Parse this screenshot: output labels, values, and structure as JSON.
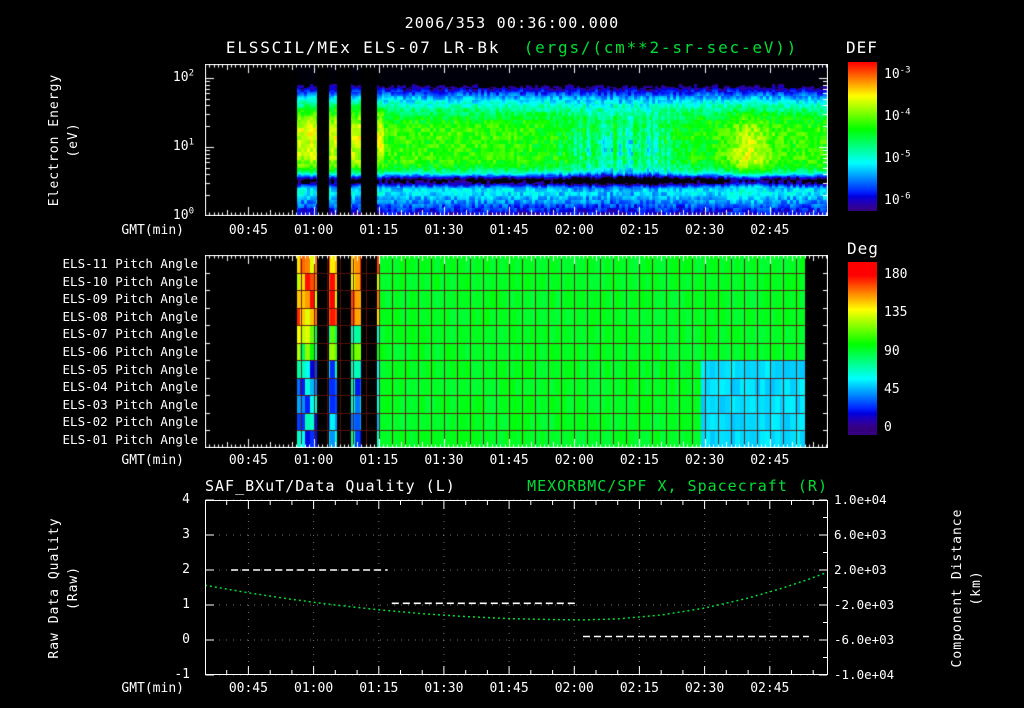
{
  "colors": {
    "accent_green": "#00dd33",
    "background": "#000000",
    "foreground": "#ffffff"
  },
  "header": {
    "timestamp": "2006/353 00:36:00.000"
  },
  "time_axis": {
    "label": "GMT(min)",
    "ticks": [
      "00:45",
      "01:00",
      "01:15",
      "01:30",
      "01:45",
      "02:00",
      "02:15",
      "02:30",
      "02:45"
    ],
    "tick_minutes": [
      45,
      60,
      75,
      90,
      105,
      120,
      135,
      150,
      165
    ],
    "start_min": 35,
    "end_min": 178.4
  },
  "spectrogram_panel": {
    "title": "ELSSCIL/MEx ELS-07 LR-Bk",
    "units": "(ergs/(cm**2-sr-sec-eV))",
    "ylabel_line1": "Electron Energy",
    "ylabel_line2": "(eV)",
    "yticks": [
      {
        "base": "10",
        "exp": "2",
        "value": 2
      },
      {
        "base": "10",
        "exp": "1",
        "value": 1
      },
      {
        "base": "10",
        "exp": "0",
        "value": 0
      }
    ],
    "y_decades_max": 2.2,
    "colorbar": {
      "title": "DEF",
      "ticks": [
        {
          "base": "10",
          "exp": "-3",
          "value": -3
        },
        {
          "base": "10",
          "exp": "-4",
          "value": -4
        },
        {
          "base": "10",
          "exp": "-5",
          "value": -5
        },
        {
          "base": "10",
          "exp": "-6",
          "value": -6
        }
      ],
      "display_range": [
        -2.69,
        -6.24
      ]
    }
  },
  "pitch_panel": {
    "rows": [
      "ELS-11 Pitch Angle",
      "ELS-10 Pitch Angle",
      "ELS-09 Pitch Angle",
      "ELS-08 Pitch Angle",
      "ELS-07 Pitch Angle",
      "ELS-06 Pitch Angle",
      "ELS-05 Pitch Angle",
      "ELS-04 Pitch Angle",
      "ELS-03 Pitch Angle",
      "ELS-02 Pitch Angle",
      "ELS-01 Pitch Angle"
    ],
    "colorbar": {
      "title": "Deg",
      "tick_labels": [
        "180",
        "135",
        "90",
        "45",
        "0"
      ],
      "tick_values": [
        180,
        135,
        90,
        45,
        0
      ],
      "display_range": [
        195,
        -8
      ]
    }
  },
  "line_panel": {
    "title_left": "SAF_BXuT/Data Quality (L)",
    "title_right": "MEXORBMC/SPF X, Spacecraft (R)",
    "ylabel_left_line1": "Raw Data Quality",
    "ylabel_left_line2": "(Raw)",
    "ylabel_right_line1": "Component Distance",
    "ylabel_right_line2": "(km)",
    "yticks_left": [
      "4",
      "3",
      "2",
      "1",
      "0",
      "-1"
    ],
    "ytick_values_left": [
      4,
      3,
      2,
      1,
      0,
      -1
    ],
    "yticks_right": [
      "1.0e+04",
      "6.0e+03",
      "2.0e+03",
      "-2.0e+03",
      "-6.0e+03",
      "-1.0e+04"
    ],
    "ytick_values_right": [
      10000,
      6000,
      2000,
      -2000,
      -6000,
      -10000
    ]
  },
  "chart_data": [
    {
      "type": "heatmap",
      "name": "electron_energy_spectrogram",
      "title": "ELSSCIL/MEx ELS-07 LR-Bk (ergs/(cm**2-sr-sec-eV))",
      "x_axis": {
        "label": "GMT(min)",
        "start_min": 35,
        "end_min": 178.4
      },
      "y_axis": {
        "label": "Electron Energy (eV)",
        "scale": "log",
        "min_ev": 1,
        "max_ev": 158,
        "log10_max": 2.2
      },
      "z_axis": {
        "label": "DEF",
        "units": "ergs/(cm**2-sr-sec-eV)",
        "log_max_display": -2.69,
        "log_min_display": -6.24
      },
      "data_start_min": 56,
      "data_end_min": 178.4,
      "gap_intervals_min": [
        [
          60.7,
          63.5
        ],
        [
          65.3,
          68.5
        ],
        [
          70.8,
          74.5
        ]
      ],
      "spectrum_model": {
        "peak_log10_ev": 1.2,
        "peak_log_flux": -4.15,
        "width_above": 4.5,
        "width_below": 1.35,
        "secondary_band": {
          "center_log10_ev": 0.82,
          "amp": 0.2,
          "sigma": 0.11
        },
        "dark_lane": {
          "center_log10_ev": 0.52,
          "amp": -1.6,
          "sigma": 0.09
        },
        "early_boost": {
          "end_min": 76,
          "amp": 0.55,
          "center_log10_ev": 1.15,
          "sigma_log10_ev": 0.5
        },
        "disturbance": {
          "center_min": 131,
          "sigma_min": 14,
          "amp": -0.75,
          "center_log10_ev": 1.0,
          "sigma_log10_ev": 0.5
        },
        "late_blob": {
          "center_min": 160,
          "sigma_min": 4.5,
          "amp": 0.55,
          "center_log10_ev": 0.9,
          "sigma_log10_ev": 0.55
        },
        "noise_amp": 0.5
      }
    },
    {
      "type": "heatmap",
      "name": "pitch_angle_panel",
      "rows": [
        "ELS-11 Pitch Angle",
        "ELS-10 Pitch Angle",
        "ELS-09 Pitch Angle",
        "ELS-08 Pitch Angle",
        "ELS-07 Pitch Angle",
        "ELS-06 Pitch Angle",
        "ELS-05 Pitch Angle",
        "ELS-04 Pitch Angle",
        "ELS-03 Pitch Angle",
        "ELS-02 Pitch Angle",
        "ELS-01 Pitch Angle"
      ],
      "value_units": "deg",
      "value_range": [
        0,
        180
      ],
      "data_start_min": 56,
      "data_end_min": 173,
      "gap_intervals_min": [
        [
          60.7,
          63.5
        ],
        [
          65.3,
          68.5
        ],
        [
          70.8,
          74.5
        ]
      ],
      "background_deg": 93,
      "noise_deg": 7,
      "stripe_interval_min": [
        56,
        75
      ],
      "stripe_values": {
        "top_rows": [
          128,
          180
        ],
        "mid_rows": [
          60,
          140
        ],
        "bottom_rows": [
          16,
          74
        ]
      },
      "late_region": {
        "start_min": 149,
        "first_row_index": 6,
        "value_deg": 52
      },
      "grid": {
        "cell_min": 3,
        "color": "#5c140c"
      }
    },
    {
      "type": "line",
      "name": "data_quality_and_spacecraft_distance",
      "ylim_left": [
        -1,
        4
      ],
      "ylim_right": [
        -10000,
        10000
      ],
      "series": [
        {
          "name": "SAF_BXuT/Data Quality (L)",
          "axis": "left",
          "color": "#ffffff",
          "style": "dashed",
          "segments": [
            {
              "t_min": [
                41,
                77
              ],
              "value": 2.0
            },
            {
              "t_min": [
                78,
                120.5
              ],
              "value": 1.05
            },
            {
              "t_min": [
                122,
                174
              ],
              "value": 0.1
            }
          ]
        },
        {
          "name": "MEXORBMC/SPF X, Spacecraft (R)",
          "axis": "right",
          "color": "#00dd33",
          "style": "dotted",
          "points_t_min": [
            35,
            45,
            55,
            65,
            75,
            85,
            95,
            105,
            115,
            122,
            130,
            140,
            150,
            160,
            168,
            174,
            178
          ],
          "points_km": [
            250,
            -600,
            -1360,
            -2000,
            -2550,
            -2990,
            -3320,
            -3550,
            -3670,
            -3700,
            -3590,
            -3140,
            -2350,
            -1210,
            -60,
            950,
            1690
          ]
        }
      ]
    }
  ]
}
